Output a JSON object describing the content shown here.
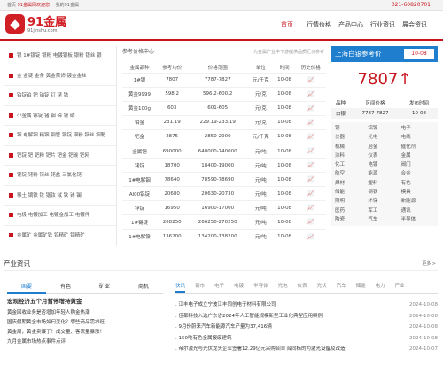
{
  "topbar": {
    "home": "首页",
    "welcome": "91金属网欢迎您！",
    "links": "我的91金属",
    "phone": "021-60820701"
  },
  "logo": {
    "mark": "◆",
    "name": "91金属",
    "domain": "91jinshu.com"
  },
  "nav": [
    "首页",
    "行情价格",
    "产品中心",
    "行业资讯",
    "展会资讯"
  ],
  "categories": [
    "银 1#银锭 银粉 电镀银板 银粉 银丝 银",
    "金 金锭 金条 黄金首饰 镀金金丝",
    "铂锭铂 钯 铂锭 钌 铑 铱",
    "小金属 镓锭 锗 铟 碲 铋 硒",
    "铟 电解铟 精铟 钢管 铟锭 铟粉 铟丝 铟靶",
    "钯锭 钯 钯粉 钯片 钯金 钯碳 钯网",
    "铑锭 铑粉 铑丝 铑盐 三氯化铑",
    "稀土 镝铁 钕 镨钕 铽 钬 铈 镧",
    "电极 电镀加工 电镀金加工 电镀件",
    "金属矿 金属矿铁 钨精矿 钼精矿"
  ],
  "middle": {
    "title": "参考价格中心",
    "note": "为金属产业中下游提供品质汇价参考",
    "headers": [
      "金属品种",
      "参考均价",
      "价格范围",
      "单位",
      "时间",
      "历史价格"
    ],
    "rows": [
      [
        "1#银",
        "7807",
        "7787-7827",
        "元/千克",
        "10-08"
      ],
      [
        "黄金9999",
        "598.2",
        "596.2-600.2",
        "元/克",
        "10-08"
      ],
      [
        "黄金100g",
        "603",
        "601-605",
        "元/克",
        "10-08"
      ],
      [
        "铂金",
        "231.19",
        "229.19-233.19",
        "元/克",
        "10-08"
      ],
      [
        "钯金",
        "2875",
        "2850-2900",
        "元/千克",
        "10-08"
      ],
      [
        "金属钯",
        "690000",
        "640000-740000",
        "元/吨",
        "10-08"
      ],
      [
        "铑锭",
        "18700",
        "18400-19000",
        "元/吨",
        "10-08"
      ],
      [
        "1#电解铟",
        "78640",
        "78590-78690",
        "元/吨",
        "10-08"
      ],
      [
        "Al00铝锭",
        "20680",
        "20630-20730",
        "元/吨",
        "10-08"
      ],
      [
        "锌锭",
        "16950",
        "16900-17000",
        "元/吨",
        "10-08"
      ],
      [
        "1#锡锭",
        "268250",
        "266250-270250",
        "元/吨",
        "10-08"
      ],
      [
        "1#电解镍",
        "136200",
        "134200-138200",
        "元/吨",
        "10-08"
      ]
    ]
  },
  "right": {
    "title": "上海白银参考价",
    "date": "10-08",
    "price": "7807↑",
    "headers": [
      "品种",
      "区间价格",
      "发布时间"
    ],
    "row": [
      "白银",
      "7787-7827",
      "10-08"
    ],
    "grid": [
      "铜",
      "铝镍",
      "电子",
      "仪器",
      "光电",
      "电线",
      "机械",
      "冶金",
      "催化剂",
      "涂料",
      "仪表",
      "金属",
      "化工",
      "电镀",
      "阀门",
      "航空",
      "能源",
      "合金",
      "焊材",
      "塑料",
      "有色",
      "储能",
      "钢铁",
      "模具",
      "照明",
      "环保",
      "新能源",
      "医药",
      "军工",
      "通讯",
      "陶瓷",
      "汽车",
      "半导体"
    ]
  },
  "section": {
    "title": "产业资讯",
    "more": "更多 >"
  },
  "leftTabs": [
    "国要",
    "有色",
    "矿业",
    "商机"
  ],
  "leftNews": [
    "宏观经济五个月暂停增持黄金",
    "黄金回收业务是否增加年轻人购金热潮",
    "国庆假期黄金市场如何变化？哪些商品需求旺",
    "黄金周，黄金卖爆了！成交量、客流量暴涨！",
    "九月金属市场热点事件点评"
  ],
  "rightTabs": [
    "快讯",
    "钢市",
    "电子",
    "电镀",
    "半导体",
    "光电",
    "仪表",
    "光伏",
    "汽车",
    "储能",
    "电力",
    "产业"
  ],
  "rightNews": [
    [
      "江丰电子成立宁波江丰同创电子材料有限公司",
      "2024-10-08"
    ],
    [
      "佳都科技入选广东省2024年人工智能规模新型工业化典型应用案例",
      "2024-10-08"
    ],
    [
      "9月份蔚来汽车新能源汽车产量为37,416辆",
      "2024-10-08"
    ],
    [
      "150吨有色金属报废建筑",
      "2024-10-08"
    ],
    [
      "帝尔激光与光伏龙头企业签署12.29亿元采购合同 合同标的为激光设备及改造",
      "2024-10-07"
    ]
  ]
}
